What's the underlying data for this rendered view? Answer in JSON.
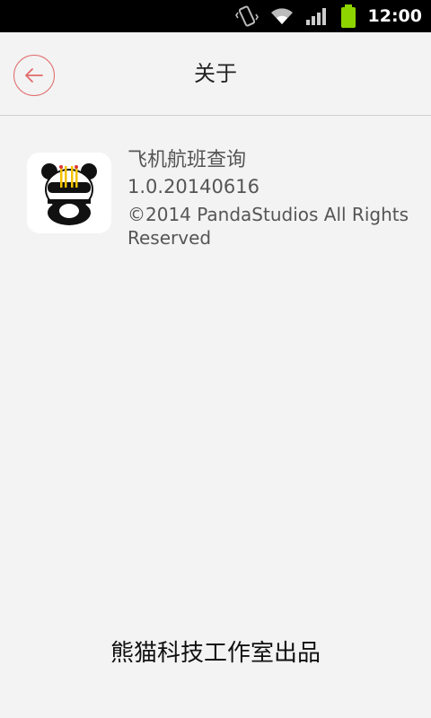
{
  "status_bar": {
    "time": "12:00",
    "icons": [
      "vibrate-icon",
      "wifi-icon",
      "signal-icon",
      "battery-icon"
    ]
  },
  "header": {
    "title": "关于",
    "back_icon": "arrow-left-icon"
  },
  "app_info": {
    "icon": "panda-app-icon",
    "name": "飞机航班查询",
    "version": "1.0.20140616",
    "copyright": "©2014 PandaStudios All Rights Reserved"
  },
  "footer": {
    "text": "熊猫科技工作室出品"
  },
  "colors": {
    "background": "#f3f3f3",
    "accent": "#e06b6b",
    "status_bar": "#000000",
    "battery": "#8ed400"
  }
}
